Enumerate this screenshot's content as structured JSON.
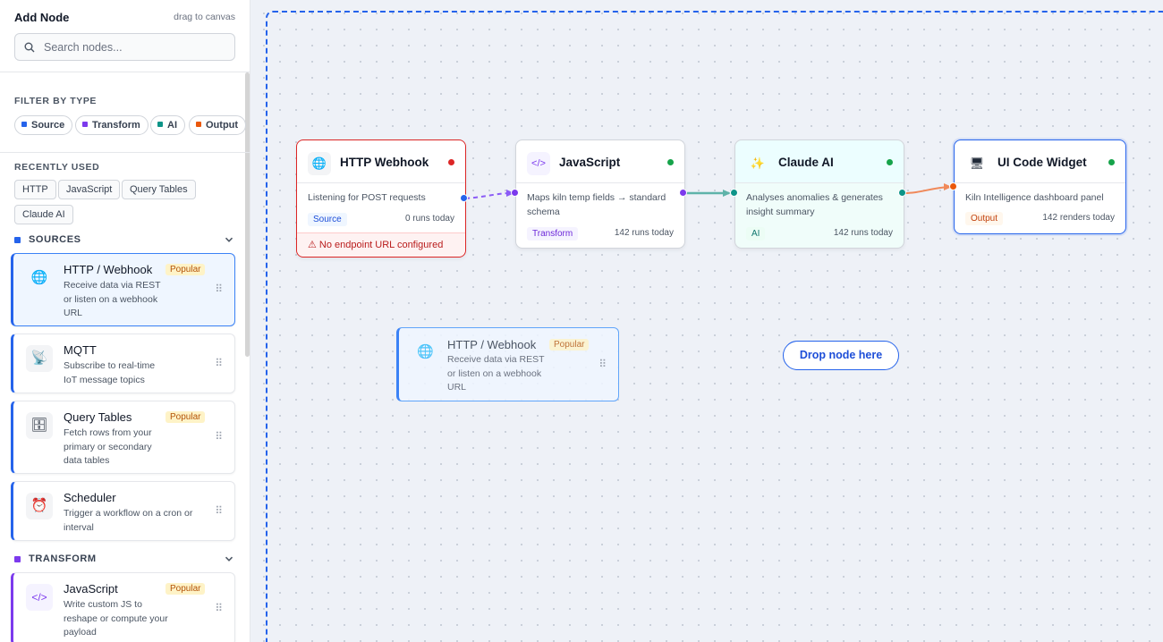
{
  "sidebar": {
    "title": "Add Node",
    "hint": "drag to canvas",
    "search_placeholder": "Search nodes...",
    "filter_label": "FILTER BY TYPE",
    "filters": [
      {
        "label": "Source",
        "color": "#2563eb"
      },
      {
        "label": "Transform",
        "color": "#7c3aed"
      },
      {
        "label": "AI",
        "color": "#0d9488"
      },
      {
        "label": "Output",
        "color": "#ea580c"
      }
    ],
    "recent_label": "RECENTLY USED",
    "recent": [
      "HTTP",
      "JavaScript",
      "Query Tables",
      "Claude AI"
    ],
    "groups": {
      "sources": {
        "label": "SOURCES",
        "color": "#2563eb",
        "items": [
          {
            "name": "HTTP / Webhook",
            "desc": "Receive data via REST or listen on a webhook URL",
            "badge": "Popular",
            "icon": "globe-icon",
            "glyph": "🌐"
          },
          {
            "name": "MQTT",
            "desc": "Subscribe to real-time IoT message topics",
            "badge": "",
            "icon": "antenna-icon",
            "glyph": "📡"
          },
          {
            "name": "Query Tables",
            "desc": "Fetch rows from your primary or secondary data tables",
            "badge": "Popular",
            "icon": "database-icon",
            "glyph": "🗄"
          },
          {
            "name": "Scheduler",
            "desc": "Trigger a workflow on a cron or interval",
            "badge": "",
            "icon": "alarm-clock-icon",
            "glyph": "⏰"
          }
        ]
      },
      "transform": {
        "label": "TRANSFORM",
        "color": "#7c3aed",
        "items": [
          {
            "name": "JavaScript",
            "desc": "Write custom JS to reshape or compute your payload",
            "badge": "Popular",
            "icon": "code-icon",
            "glyph": "</>"
          }
        ]
      }
    },
    "grip": "⠿"
  },
  "canvas": {
    "nodes": [
      {
        "name": "HTTP Webhook",
        "glyph": "🌐",
        "icon": "globe-icon",
        "status_color": "#dc2626",
        "desc": "Listening for POST requests",
        "tag": "Source",
        "tag_color": "#1d4ed8",
        "tag_bg": "#eff6ff",
        "runs": "0 runs today",
        "error": "⚠ No endpoint URL configured"
      },
      {
        "name": "JavaScript",
        "glyph": "</>",
        "icon": "code-icon",
        "status_color": "#16a34a",
        "desc": "Maps kiln temp fields → standard schema",
        "tag": "Transform",
        "tag_color": "#6d28d9",
        "tag_bg": "#f5f3ff",
        "runs": "142 runs today"
      },
      {
        "name": "Claude AI",
        "glyph": "✨",
        "icon": "sparkle-icon",
        "status_color": "#16a34a",
        "desc": "Analyses anomalies & generates insight summary",
        "tag": "AI",
        "tag_color": "#0f766e",
        "tag_bg": "#ecfdf5",
        "runs": "142 runs today"
      },
      {
        "name": "UI Code Widget",
        "glyph": "🖥",
        "icon": "monitor-icon",
        "status_color": "#16a34a",
        "desc": "Kiln Intelligence dashboard panel",
        "tag": "Output",
        "tag_color": "#c2410c",
        "tag_bg": "#fff7ed",
        "runs": "142 renders today"
      }
    ],
    "ghost": {
      "name": "HTTP / Webhook",
      "desc": "Receive data via REST or listen on a webhook URL",
      "badge": "Popular",
      "glyph": "🌐"
    },
    "drop_label": "Drop node here"
  }
}
